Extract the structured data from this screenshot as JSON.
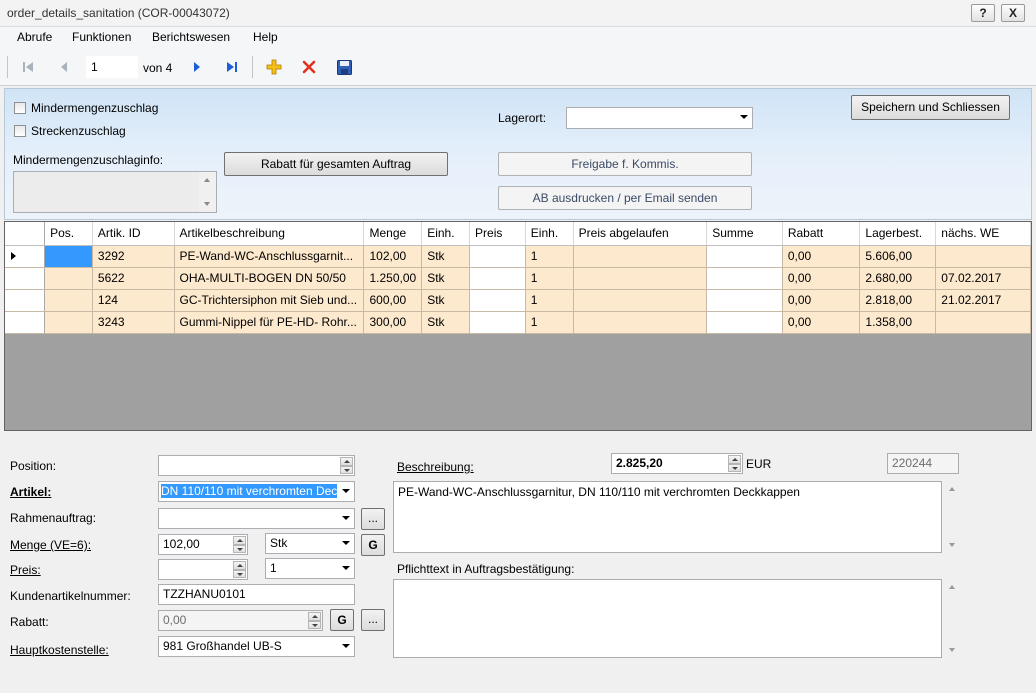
{
  "window": {
    "title": "order_details_sanitation (COR-00043072)",
    "help_label": "?",
    "close_label": "X"
  },
  "menu": [
    "Abrufe",
    "Funktionen",
    "Berichtswesen",
    "Help"
  ],
  "nav": {
    "position": "1",
    "of_label": "von 4"
  },
  "top": {
    "chk_mindermengen": "Mindermengenzuschlag",
    "chk_strecken": "Streckenzuschlag",
    "info_label": "Mindermengenzuschlaginfo:",
    "rabatt_button": "Rabatt für gesamten Auftrag",
    "lagerort_label": "Lagerort:",
    "lagerort_value": "",
    "freigabe_button": "Freigabe f. Kommis.",
    "ab_button": "AB ausdrucken / per Email senden",
    "save_close_button": "Speichern und Schliessen"
  },
  "grid": {
    "columns": [
      "Pos.",
      "Artik. ID",
      "Artikelbeschreibung",
      "Menge",
      "Einh.",
      "Preis",
      "Einh.",
      "Preis abgelaufen",
      "Summe",
      "Rabatt",
      "Lagerbest.",
      "nächs. WE"
    ],
    "rows": [
      [
        "",
        "3292",
        "PE-Wand-WC-Anschlussgarnit...",
        "102,00",
        "Stk",
        "",
        "1",
        "",
        "",
        "0,00",
        "5.606,00",
        ""
      ],
      [
        "",
        "5622",
        "OHA-MULTI-BOGEN DN 50/50",
        "1.250,00",
        "Stk",
        "",
        "1",
        "",
        "",
        "0,00",
        "2.680,00",
        "07.02.2017"
      ],
      [
        "",
        "124",
        "GC-Trichtersiphon mit Sieb und...",
        "600,00",
        "Stk",
        "",
        "1",
        "",
        "",
        "0,00",
        "2.818,00",
        "21.02.2017"
      ],
      [
        "",
        "3243",
        "Gummi-Nippel für PE-HD- Rohr...",
        "300,00",
        "Stk",
        "",
        "1",
        "",
        "",
        "0,00",
        "1.358,00",
        ""
      ]
    ]
  },
  "detail": {
    "position_label": "Position:",
    "position_value": "",
    "artikel_label": "Artikel:",
    "artikel_value": "DN 110/110 mit verchromten Dec",
    "rahmen_label": "Rahmenauftrag:",
    "rahmen_value": "",
    "dots": "...",
    "menge_label": "Menge (VE=6):",
    "menge_value": "102,00",
    "menge_unit": "Stk",
    "g_label": "G",
    "preis_label": "Preis:",
    "preis_value": "",
    "preis_unit": "1",
    "kundenart_label": "Kundenartikelnummer:",
    "kundenart_value": "TZZHANU0101",
    "rabatt_label": "Rabatt:",
    "rabatt_value": "0,00",
    "hks_label": "Hauptkostenstelle:",
    "hks_value": "981  Großhandel UB-S",
    "beschreibung_label": "Beschreibung:",
    "sum_value": "2.825,20",
    "currency": "EUR",
    "id_value": "220244",
    "beschreibung_text": "PE-Wand-WC-Anschlussgarnitur, DN 110/110 mit verchromten Deckkappen",
    "pflicht_label": "Pflichttext in  Auftragsbestätigung:",
    "pflicht_text": ""
  }
}
